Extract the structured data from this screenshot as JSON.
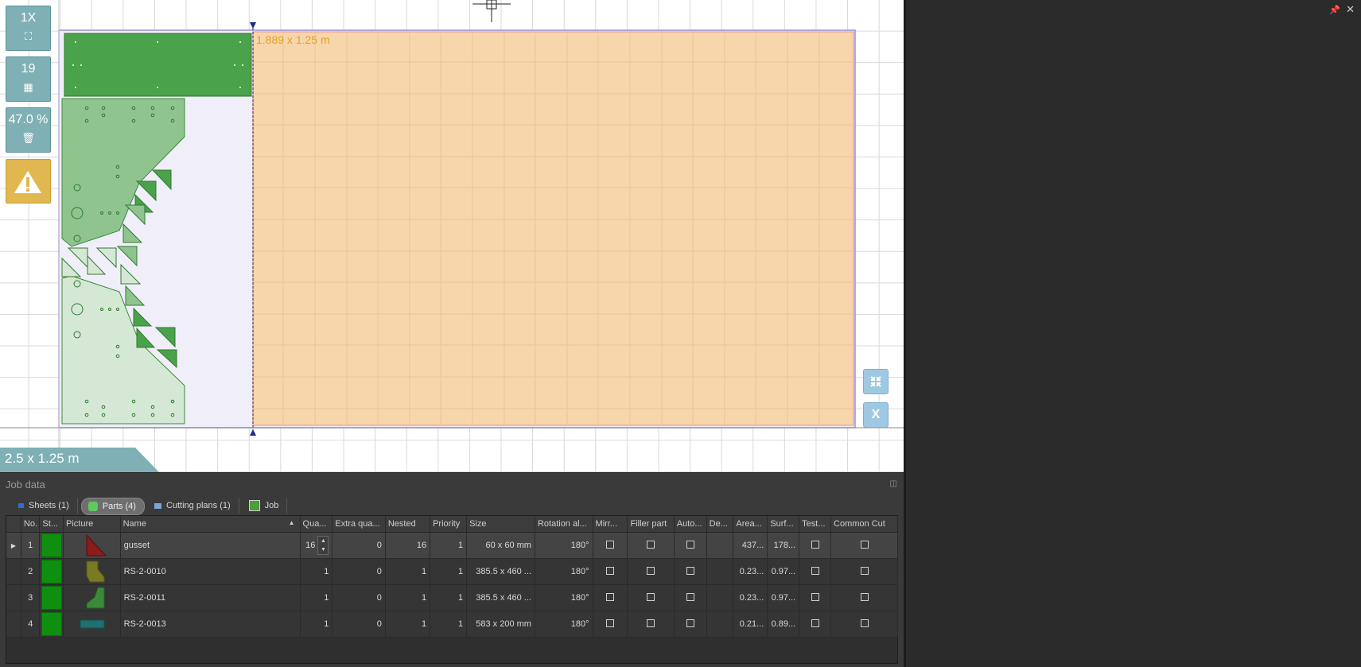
{
  "canvas": {
    "zoom_label": "1X",
    "parts_count": "19",
    "usage_label": "47.0 %",
    "sheet_size_label": "1.889 x 1.25 m",
    "full_sheet_label": "2.5 x 1.25 m",
    "shrink_btn_icon": "compress-arrows-icon",
    "close_btn_label": "X"
  },
  "job": {
    "title": "Job data",
    "tabs": [
      {
        "label": "Sheets (1)",
        "icon": "sheet-icon",
        "active": false
      },
      {
        "label": "Parts (4)",
        "icon": "puzzle-icon",
        "active": true
      },
      {
        "label": "Cutting plans (1)",
        "icon": "cutting-plan-icon",
        "active": false
      },
      {
        "label": "Job",
        "icon": "job-icon",
        "active": false
      }
    ],
    "columns": [
      "No.",
      "St...",
      "Picture",
      "Name",
      "Qua...",
      "Extra qua...",
      "Nested",
      "Priority",
      "Size",
      "Rotation al...",
      "Mirr...",
      "Filler part",
      "Auto...",
      "De...",
      "Area...",
      "Surf...",
      "Test...",
      "Common Cut"
    ],
    "rows": [
      {
        "no": "1",
        "name": "gusset",
        "qty": "16",
        "extra": "0",
        "nested": "16",
        "priority": "1",
        "size": "60 x 60 mm",
        "rotation": "180°",
        "area": "437...",
        "surf": "178...",
        "picture": "gusset-thumbnail",
        "selected": true
      },
      {
        "no": "2",
        "name": "RS-2-0010",
        "qty": "1",
        "extra": "0",
        "nested": "1",
        "priority": "1",
        "size": "385.5 x 460 ...",
        "rotation": "180°",
        "area": "0.23...",
        "surf": "0.97...",
        "picture": "rs-2-0010-thumbnail",
        "selected": false
      },
      {
        "no": "3",
        "name": "RS-2-0011",
        "qty": "1",
        "extra": "0",
        "nested": "1",
        "priority": "1",
        "size": "385.5 x 460 ...",
        "rotation": "180°",
        "area": "0.23...",
        "surf": "0.97...",
        "picture": "rs-2-0011-thumbnail",
        "selected": false
      },
      {
        "no": "4",
        "name": "RS-2-0013",
        "qty": "1",
        "extra": "0",
        "nested": "1",
        "priority": "1",
        "size": "583 x 200 mm",
        "rotation": "180°",
        "area": "0.21...",
        "surf": "0.89...",
        "picture": "rs-2-0013-thumbnail",
        "selected": false
      }
    ]
  },
  "colors": {
    "sheet_used": "#f0eef9",
    "sheet_remnant": "#f7d6ab",
    "part_fill": "#4aa24a",
    "part_light": "#d5e8d5",
    "status_green": "#0f8f0f",
    "warning": "#e0b84f",
    "accent_teal": "#7fb0b5"
  }
}
